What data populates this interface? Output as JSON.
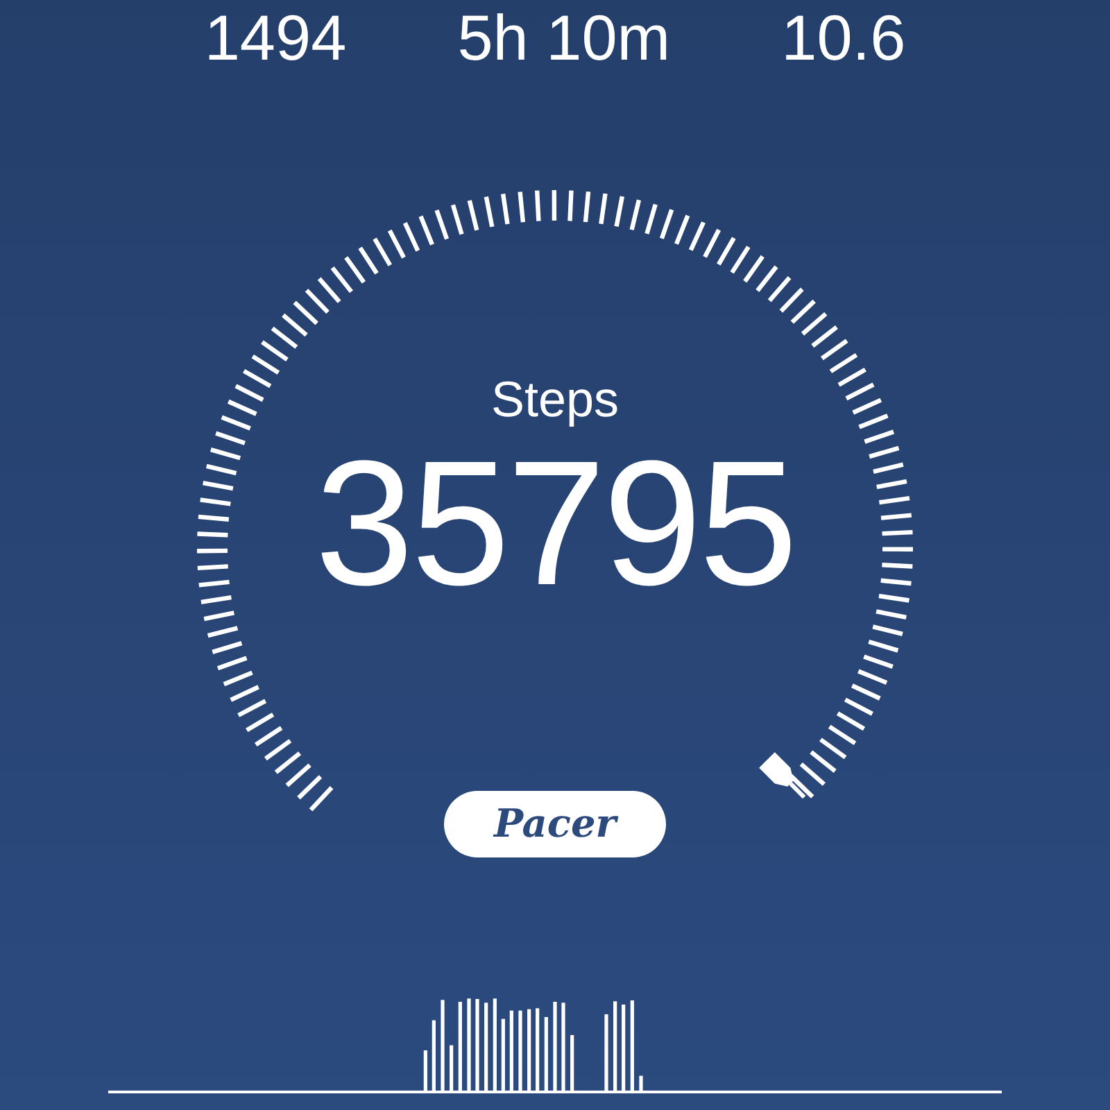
{
  "stats": [
    {
      "value": "1494"
    },
    {
      "value": "5h 10m"
    },
    {
      "value": "10.6"
    }
  ],
  "gauge": {
    "label": "Steps",
    "value": "35795"
  },
  "logo": "Pacer"
}
